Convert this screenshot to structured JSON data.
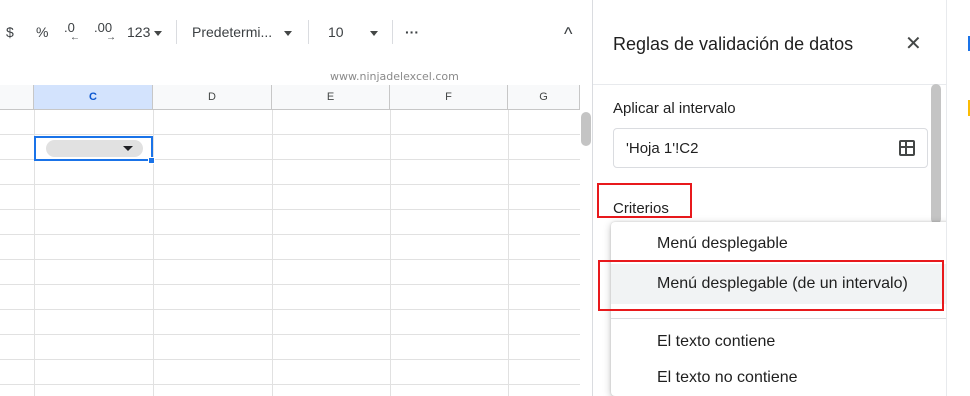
{
  "toolbar": {
    "currency": "$",
    "percent": "%",
    "decrease_decimals": ".0",
    "increase_decimals": ".00",
    "number_format": "123",
    "font_name": "Predetermi...",
    "font_size": "10",
    "more": "···",
    "collapse": "^"
  },
  "watermark": "www.ninjadelexcel.com",
  "grid": {
    "columns": [
      "C",
      "D",
      "E",
      "F",
      "G"
    ]
  },
  "panel": {
    "title": "Reglas de validación de datos",
    "close": "✕",
    "apply_label": "Aplicar al intervalo",
    "range_value": "'Hoja 1'!C2",
    "criteria_label": "Criterios"
  },
  "menu": {
    "items": [
      "Menú desplegable",
      "Menú desplegable (de un intervalo)",
      "El texto contiene",
      "El texto no contiene"
    ]
  },
  "colors": {
    "accent": "#1a73e8",
    "highlight_red": "#e8191c"
  }
}
